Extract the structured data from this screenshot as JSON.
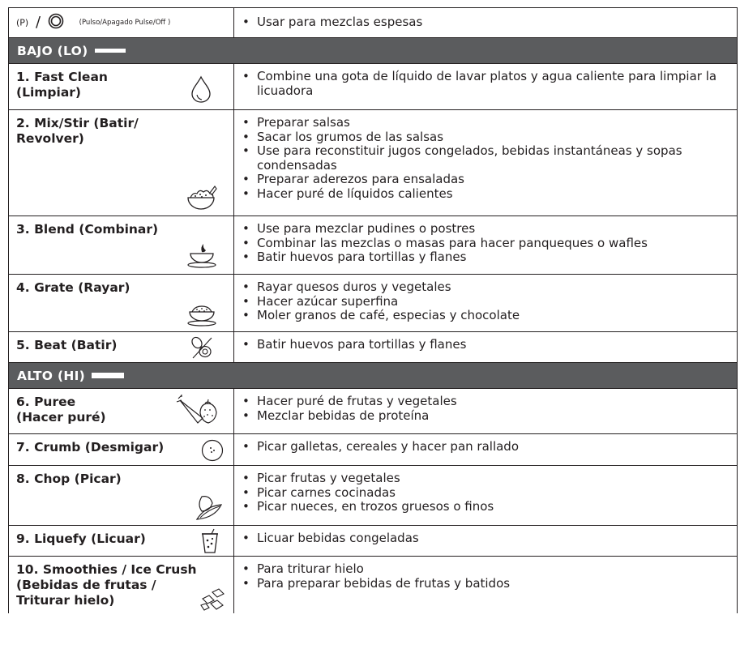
{
  "pulse": {
    "p_icon": "(P)",
    "slash": "/",
    "label": "(Pulso/Apagado Pulse/Off )",
    "items": [
      "Usar para mezclas espesas"
    ]
  },
  "sections": {
    "lo": "BAJO (LO)",
    "hi": "ALTO (HI)"
  },
  "rows": [
    {
      "name": "1. Fast Clean\n(Limpiar)",
      "icon": "water-drop-icon",
      "items": [
        "Combine una gota de líquido de lavar platos y agua caliente para limpiar la licuadora"
      ]
    },
    {
      "name": "2. Mix/Stir (Batir/\nRevolver)",
      "icon": "salad-bowl-icon",
      "items": [
        "Preparar salsas",
        "Sacar los grumos de las salsas",
        "Use para reconstituir jugos congelados, bebidas instantáneas y sopas condensadas",
        "Preparar aderezos para ensaladas",
        "Hacer puré de líquidos calientes"
      ]
    },
    {
      "name": "3. Blend (Combinar)",
      "icon": "pudding-bowl-icon",
      "items": [
        "Use para mezclar pudines o postres",
        "Combinar las mezclas o masas para hacer panqueques o wafles",
        "Batir huevos para tortillas y flanes"
      ]
    },
    {
      "name": "4. Grate (Rayar)",
      "icon": "grated-bowl-icon",
      "items": [
        "Rayar quesos duros y vegetales",
        "Hacer azúcar superfina",
        "Moler granos de café, especias y chocolate"
      ]
    },
    {
      "name": "5. Beat (Batir)",
      "icon": "eggs-icon",
      "items": [
        "Batir huevos para tortillas y flanes"
      ]
    },
    {
      "name": "6. Puree\n   (Hacer puré)",
      "icon": "fruit-vegetable-icon",
      "items": [
        "Hacer puré de frutas y vegetales",
        "Mezclar bebidas de proteína"
      ]
    },
    {
      "name": "7. Crumb (Desmigar)",
      "icon": "cookie-icon",
      "items": [
        "Picar galletas, cereales y hacer pan rallado"
      ]
    },
    {
      "name": "8. Chop (Picar)",
      "icon": "vegetables-icon",
      "items": [
        "Picar frutas y vegetales",
        "Picar carnes cocinadas",
        "Picar nueces, en trozos gruesos o finos"
      ]
    },
    {
      "name": "9. Liquefy (Licuar)",
      "icon": "drink-cup-icon",
      "items": [
        "Licuar bebidas congeladas"
      ]
    },
    {
      "name": "10. Smoothies / Ice Crush\n(Bebidas de frutas /\nTriturar hielo)",
      "icon": "ice-cubes-icon",
      "items": [
        "Para triturar hielo",
        "Para preparar bebidas de frutas y batidos"
      ]
    }
  ]
}
